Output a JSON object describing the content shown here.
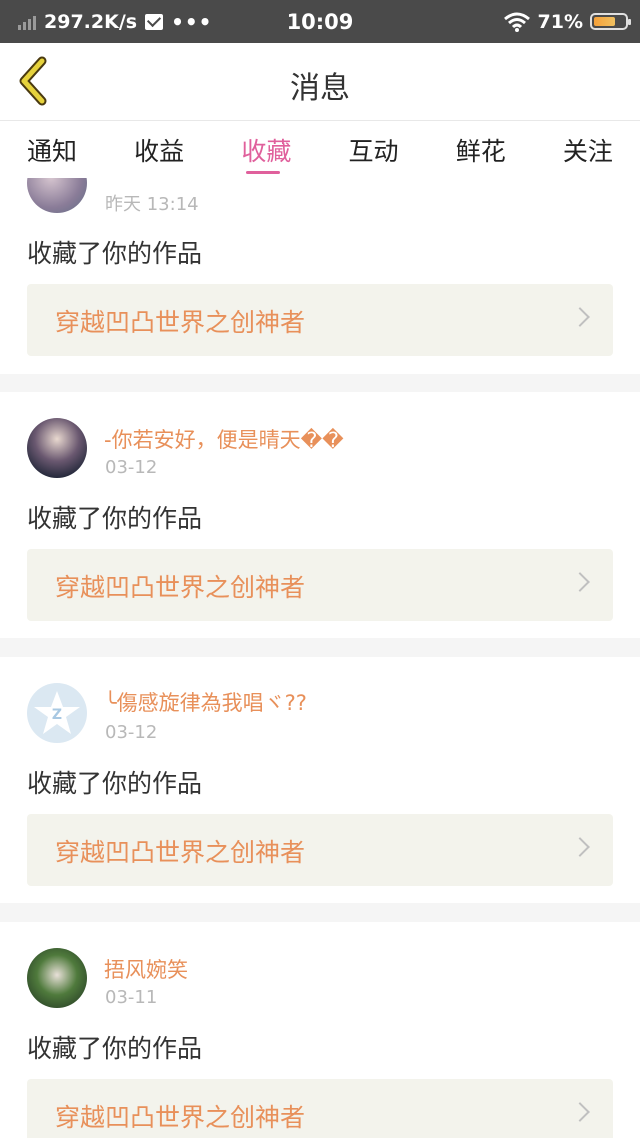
{
  "status_bar": {
    "speed": "297.2K/s",
    "dots": "•••",
    "time": "10:09",
    "battery": "71%"
  },
  "header": {
    "title": "消息"
  },
  "tabs": [
    {
      "label": "通知"
    },
    {
      "label": "收益"
    },
    {
      "label": "收藏"
    },
    {
      "label": "互动"
    },
    {
      "label": "鲜花"
    },
    {
      "label": "关注"
    }
  ],
  "feed": [
    {
      "username": "",
      "date": "昨天 13:14",
      "action": "收藏了你的作品",
      "work": "穿越凹凸世界之创神者"
    },
    {
      "username": "-你若安好，便是晴天��",
      "date": "03-12",
      "action": "收藏了你的作品",
      "work": "穿越凹凸世界之创神者"
    },
    {
      "username": "╰傷感旋律為我唱ヾ??",
      "date": "03-12",
      "action": "收藏了你的作品",
      "work": "穿越凹凸世界之创神者"
    },
    {
      "username": "捂风婉笑",
      "date": "03-11",
      "action": "收藏了你的作品",
      "work": "穿越凹凸世界之创神者"
    }
  ],
  "colors": {
    "accent": "#e0609c",
    "username": "#e8905a",
    "back_arrow": "#e6d23c"
  }
}
